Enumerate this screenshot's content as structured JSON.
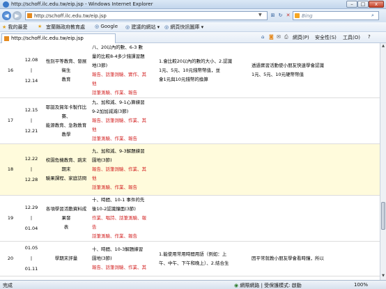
{
  "window": {
    "title": "http://schoff.ilc.edu.tw/eip.jsp - Windows Internet Explorer",
    "controls": {
      "minimize": "–",
      "maximize": "□",
      "close": "x"
    }
  },
  "navbar": {
    "url": "http://schoff.ilc.edu.tw/eip.jsp",
    "search_placeholder": "Bing"
  },
  "favorites": {
    "label": "我的最愛",
    "items": [
      "宜蘭縣政府教育處",
      "Google",
      "建議的網站",
      "網頁快訊圖庫"
    ]
  },
  "commandbar": {
    "tab_title": "http://schoff.ilc.edu.tw/eip.jsp",
    "items": [
      "網頁(P)",
      "安全性(S)",
      "工具(O)",
      "?"
    ]
  },
  "rows": [
    {
      "week": "16",
      "date_start": "12.08",
      "date_end": "12.14",
      "topic": [
        "性別平等教育、發展衛生",
        "教育"
      ],
      "activity": [
        {
          "text": "八、20以內的數、6-3 數",
          "red": false
        },
        {
          "text": "量的比較8-4多少錢課習題",
          "red": false
        },
        {
          "text": "地(3節)",
          "red": false
        },
        {
          "text": "報告、話筆測驗、實作、其",
          "red": true
        },
        {
          "text": "他",
          "red": true
        },
        {
          "text": "話筆測驗、作業、報告",
          "red": true
        }
      ],
      "goal": [
        "1.會比較20以內的數的大小、2.認識",
        "1元、5元、10元錢幣幣值，並",
        "會1元與10元錢幣的換算"
      ],
      "objective": [
        "透過實習活動使小朋友快速學會認識",
        "1元、5元、10元硬幣幣值"
      ],
      "highlight": false
    },
    {
      "week": "17",
      "date_start": "12.15",
      "date_end": "12.21",
      "topic": [
        "耶誕及賀年卡製作比賽、",
        "能源教育、急救教育教學"
      ],
      "activity": [
        {
          "text": "九、加和減、9-1心算練習",
          "red": false
        },
        {
          "text": "9-2加加減減(3節)",
          "red": false
        },
        {
          "text": "報告、話筆測驗、作業、其",
          "red": true
        },
        {
          "text": "他",
          "red": true
        },
        {
          "text": "話筆測驗、作業、報告",
          "red": true
        }
      ],
      "goal": [],
      "objective": [],
      "highlight": false
    },
    {
      "week": "18",
      "date_start": "12.22",
      "date_end": "12.28",
      "topic": [
        "校園危機教育、跳末期末",
        "驗果課程、家庭訪問"
      ],
      "activity": [
        {
          "text": "九、加和減、9-3解題練習",
          "red": false
        },
        {
          "text": "園地(3節)",
          "red": false
        },
        {
          "text": "報告、話筆測驗、作業、其",
          "red": true
        },
        {
          "text": "他",
          "red": true
        },
        {
          "text": "話筆測驗、作業、報告",
          "red": true
        }
      ],
      "goal": [],
      "objective": [],
      "highlight": true
    },
    {
      "week": "19",
      "date_start": "12.29",
      "date_end": "01.04",
      "topic": [
        "各項學習活動資料成果發",
        "表"
      ],
      "activity": [
        {
          "text": "十、時間、10-1 事件的先",
          "red": false
        },
        {
          "text": "後10-2認識鐘面(3節)",
          "red": false
        },
        {
          "text": "作業、唱詩、話筆測驗、報",
          "red": true
        },
        {
          "text": "告",
          "red": true
        },
        {
          "text": "話筆測驗、作業、報告",
          "red": true
        }
      ],
      "goal": [],
      "objective": [],
      "highlight": false
    },
    {
      "week": "20",
      "date_start": "01.05",
      "date_end": "01.11",
      "topic": [
        "學期末評量",
        ""
      ],
      "activity": [
        {
          "text": "十、時間、10-3解題練習",
          "red": false
        },
        {
          "text": "園地(3節)",
          "red": false
        },
        {
          "text": "報告、話筆測驗、作業、其",
          "red": true
        }
      ],
      "goal": [
        "1.能使用常用時間用語（例如：上",
        "午、中午、下午和晚上）、2.結合生"
      ],
      "objective": [
        "因平常就教小朋友學會看時鐘，所以"
      ],
      "highlight": false
    }
  ],
  "status": {
    "left": "完成",
    "zone": "網際網路 | 受保護模式: 啟動",
    "zoom": "100%"
  }
}
